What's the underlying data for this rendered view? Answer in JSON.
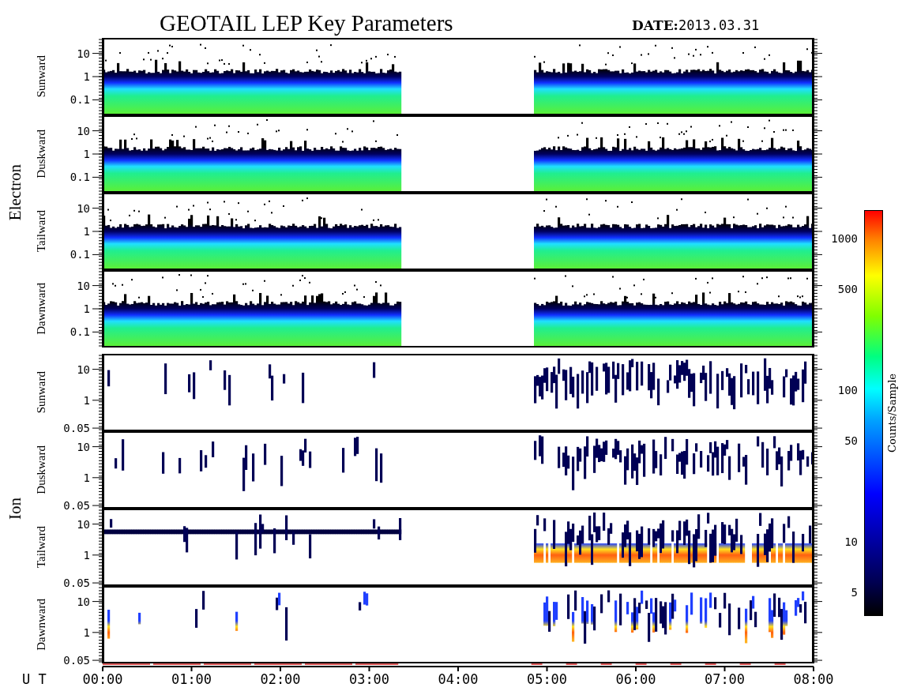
{
  "title": "GEOTAIL LEP Key Parameters",
  "date": {
    "label": "DATE:",
    "value": "2013.03.31"
  },
  "groups": [
    {
      "name": "Electron",
      "kind": "electron",
      "panels": [
        {
          "label": "Sunward",
          "y_ticks": [
            "10",
            "1",
            "0.1"
          ]
        },
        {
          "label": "Duskward",
          "y_ticks": [
            "10",
            "1",
            "0.1"
          ]
        },
        {
          "label": "Tailward",
          "y_ticks": [
            "10",
            "1",
            "0.1"
          ]
        },
        {
          "label": "Dawnward",
          "y_ticks": [
            "10",
            "1",
            "0.1"
          ]
        }
      ]
    },
    {
      "name": "Ion",
      "kind": "ion",
      "panels": [
        {
          "label": "Sunward",
          "y_ticks": [
            "10",
            "1",
            "0.05"
          ]
        },
        {
          "label": "Duskward",
          "y_ticks": [
            "10",
            "1",
            "0.05"
          ]
        },
        {
          "label": "Tailward",
          "y_ticks": [
            "10",
            "1",
            "0.05"
          ]
        },
        {
          "label": "Dawnward",
          "y_ticks": [
            "10",
            "1",
            "0.05"
          ]
        }
      ]
    }
  ],
  "x_axis": {
    "label": "U T",
    "ticks": [
      "00:00",
      "01:00",
      "02:00",
      "03:00",
      "04:00",
      "05:00",
      "06:00",
      "07:00",
      "08:00"
    ]
  },
  "colorbar": {
    "title": "Counts/Sample",
    "ticks": [
      "1000",
      "500",
      "100",
      "50",
      "10",
      "5"
    ]
  }
}
